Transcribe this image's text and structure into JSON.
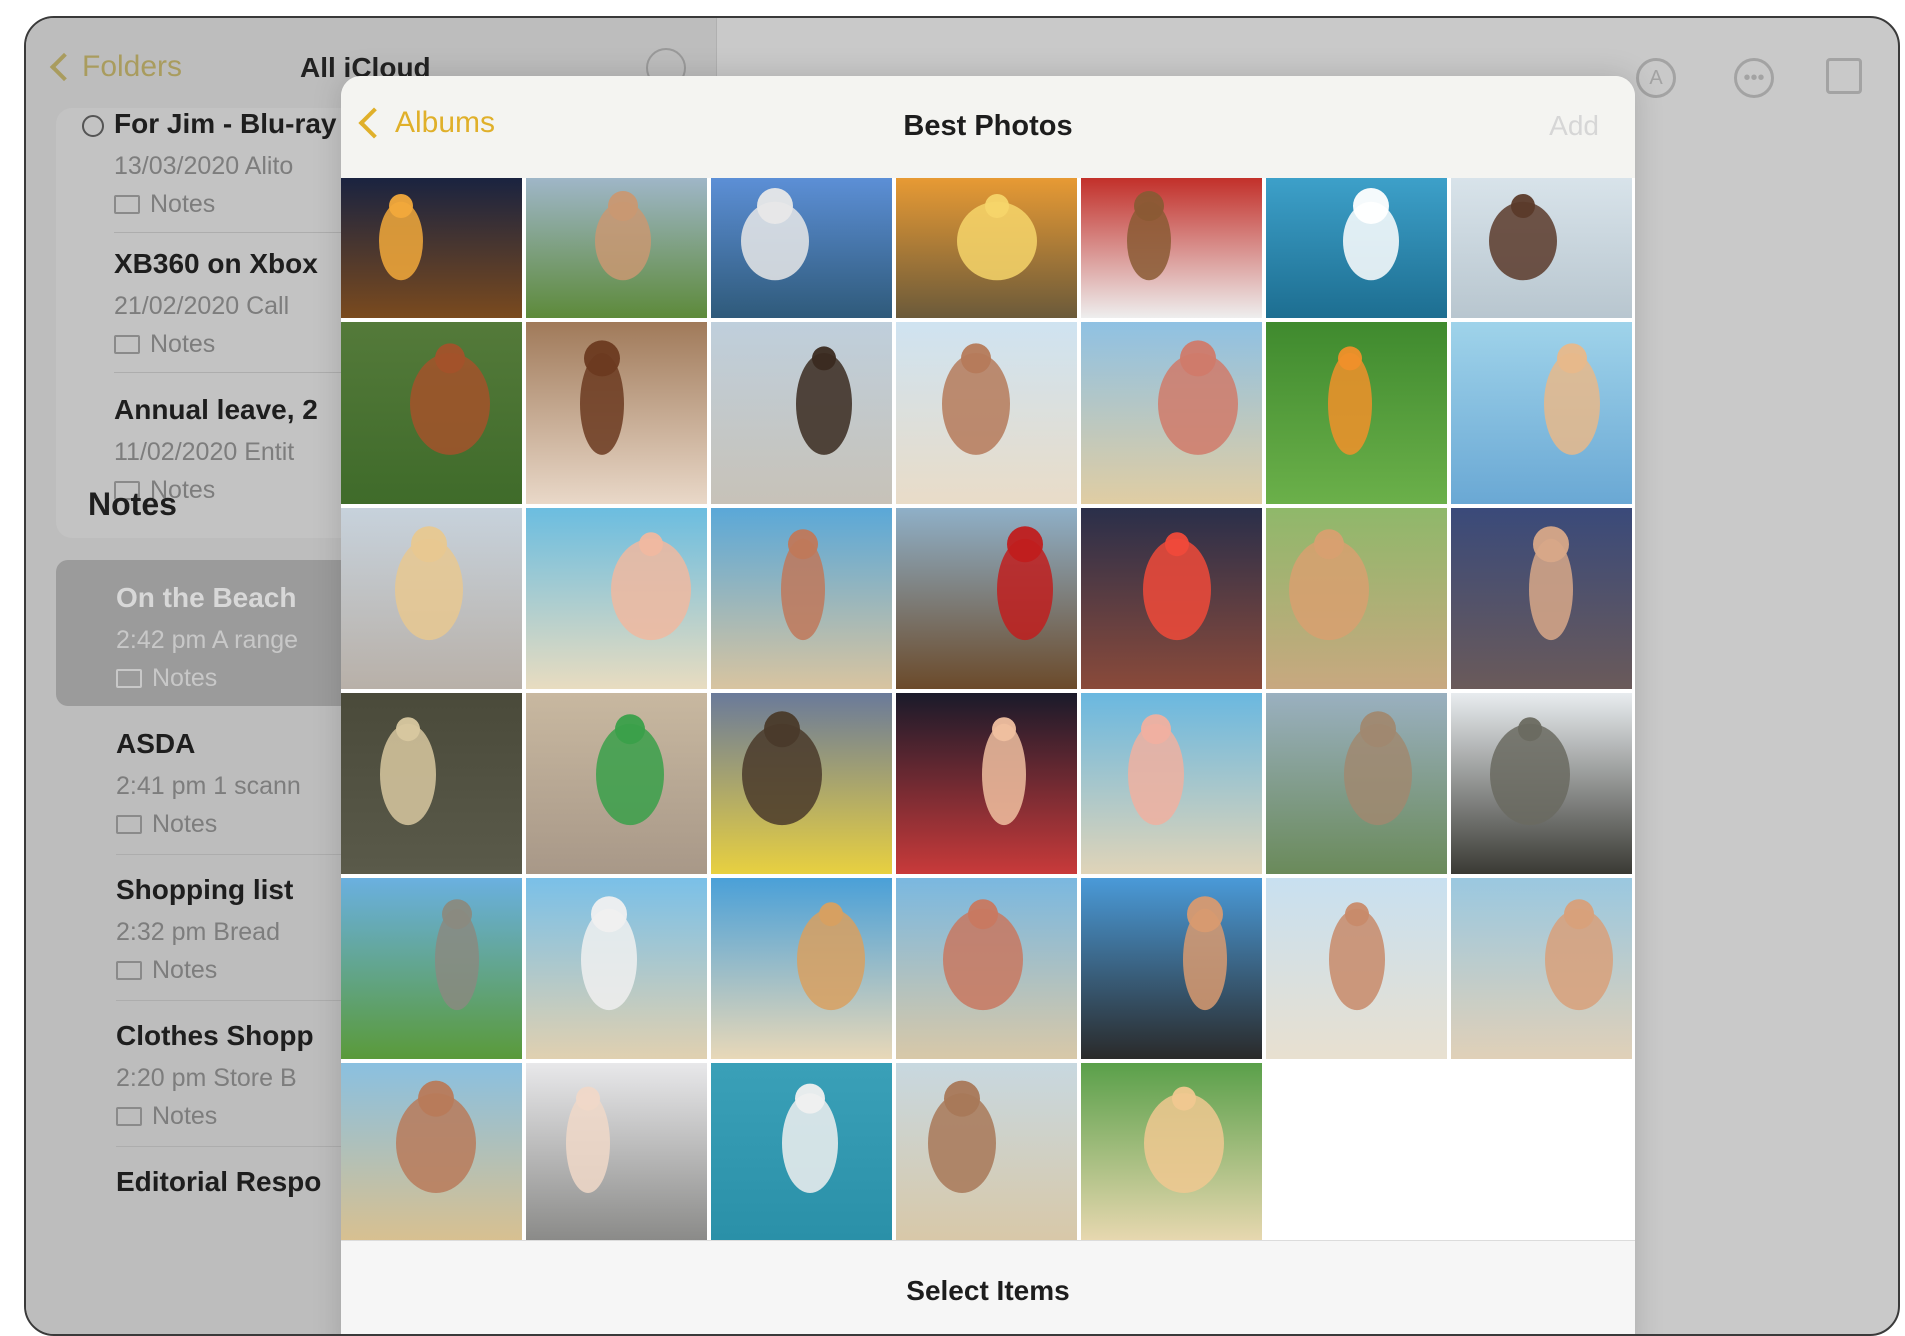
{
  "sidebar": {
    "back_label": "Folders",
    "title": "All iCloud",
    "pinned": [
      {
        "title": "For Jim - Blu-ray",
        "meta": "13/03/2020  Alito",
        "folder": "Notes"
      },
      {
        "title": "XB360 on Xbox",
        "meta": "21/02/2020  Call",
        "folder": "Notes"
      },
      {
        "title": "Annual leave, 2",
        "meta": "11/02/2020  Entit",
        "folder": "Notes"
      }
    ],
    "notes_heading": "Notes",
    "notes": [
      {
        "title": "On the Beach",
        "meta": "2:42 pm  A range",
        "folder": "Notes",
        "selected": true
      },
      {
        "title": "ASDA",
        "meta": "2:41 pm  1 scann",
        "folder": "Notes"
      },
      {
        "title": "Shopping list",
        "meta": "2:32 pm  Bread",
        "folder": "Notes"
      },
      {
        "title": "Clothes Shopp",
        "meta": "2:20 pm  Store B",
        "folder": "Notes"
      },
      {
        "title": "Editorial Respo",
        "meta": "",
        "folder": ""
      }
    ]
  },
  "toolbar": {
    "icons": [
      "markup-icon",
      "more-icon",
      "compose-icon"
    ]
  },
  "picker": {
    "back_label": "Albums",
    "title": "Best Photos",
    "add_label": "Add",
    "footer_label": "Select Items",
    "accent_color": "#e0b02a",
    "photos": [
      {
        "name": "city-night-photo",
        "sky": "#1a2340",
        "ground": "#7a4a1e",
        "accent": "#f2a93b"
      },
      {
        "name": "woman-sunglasses-photo",
        "sky": "#9fb6c8",
        "ground": "#5d8a3a",
        "accent": "#c99872"
      },
      {
        "name": "harbour-yachts-photo",
        "sky": "#5c8fd6",
        "ground": "#2f5a7a",
        "accent": "#e8e8e8"
      },
      {
        "name": "sunset-valley-photo",
        "sky": "#e79a34",
        "ground": "#6b5a3a",
        "accent": "#f6d56a"
      },
      {
        "name": "dogs-photo",
        "sky": "#c2302a",
        "ground": "#eeeeee",
        "accent": "#8a5a34"
      },
      {
        "name": "surfer-photo",
        "sky": "#3da0c9",
        "ground": "#1d6e91",
        "accent": "#ffffff"
      },
      {
        "name": "steps-photo",
        "sky": "#d8e3ea",
        "ground": "#b8c6cf",
        "accent": "#5b3a2a"
      },
      {
        "name": "horse-race-photo",
        "sky": "#547a3a",
        "ground": "#3f6b2a",
        "accent": "#a3522a"
      },
      {
        "name": "portrait-brunette-photo",
        "sky": "#a07a5a",
        "ground": "#e9d8c8",
        "accent": "#6b3a20"
      },
      {
        "name": "windswept-hair-photo",
        "sky": "#bfcfdc",
        "ground": "#c7c2b8",
        "accent": "#3a2a20"
      },
      {
        "name": "beach-runner-photo",
        "sky": "#cfe3f1",
        "ground": "#e9dcc8",
        "accent": "#b57a5a"
      },
      {
        "name": "family-beach-photo",
        "sky": "#8fc1e3",
        "ground": "#e0cda3",
        "accent": "#d07a6a"
      },
      {
        "name": "butterfly-photo",
        "sky": "#3f8a2e",
        "ground": "#6bb04a",
        "accent": "#f0902a"
      },
      {
        "name": "family-selfie-photo",
        "sky": "#9fd3ea",
        "ground": "#6aa8d4",
        "accent": "#e8b88a"
      },
      {
        "name": "eiffel-mother-photo",
        "sky": "#c7d2dc",
        "ground": "#b8b0a8",
        "accent": "#e8c890"
      },
      {
        "name": "child-sea-photo",
        "sky": "#6bbde0",
        "ground": "#e8dcc0",
        "accent": "#f0b8a0"
      },
      {
        "name": "friends-group-photo",
        "sky": "#5aa8d8",
        "ground": "#d8c4a0",
        "accent": "#c0785a"
      },
      {
        "name": "falconer-photo",
        "sky": "#8fb0c8",
        "ground": "#6b4a2a",
        "accent": "#c01e1e"
      },
      {
        "name": "times-square-photo",
        "sky": "#2a2f4a",
        "ground": "#8a4a3a",
        "accent": "#f04a3a"
      },
      {
        "name": "friends-garden-photo",
        "sky": "#8fb86a",
        "ground": "#c8a880",
        "accent": "#d8a070"
      },
      {
        "name": "women-night-photo",
        "sky": "#3a4a7a",
        "ground": "#6a5a5a",
        "accent": "#d8a888"
      },
      {
        "name": "cyclist-photo",
        "sky": "#4a4a3a",
        "ground": "#5a5a4a",
        "accent": "#d8c8a0"
      },
      {
        "name": "plaza-walker-photo",
        "sky": "#c8b8a0",
        "ground": "#a89888",
        "accent": "#3aa04a"
      },
      {
        "name": "street-woman-photo",
        "sky": "#6a7a9a",
        "ground": "#e8d040",
        "accent": "#4a3a2a"
      },
      {
        "name": "party-friends-photo",
        "sky": "#1a1a2a",
        "ground": "#c83a3a",
        "accent": "#f0c0a0"
      },
      {
        "name": "toddler-sea-photo",
        "sky": "#6ab8e0",
        "ground": "#e0d4b8",
        "accent": "#f0b0a0"
      },
      {
        "name": "mountain-lake-photo",
        "sky": "#9ab0c0",
        "ground": "#6a8a5a",
        "accent": "#a08870"
      },
      {
        "name": "tower-photo",
        "sky": "#e8ecef",
        "ground": "#3a3a34",
        "accent": "#6a6a60"
      },
      {
        "name": "alpine-meadow-photo",
        "sky": "#6ab0e0",
        "ground": "#5a9a3a",
        "accent": "#8a8a80"
      },
      {
        "name": "woman-driftwood-photo",
        "sky": "#7ac0e8",
        "ground": "#e0d0b0",
        "accent": "#f0f0f0"
      },
      {
        "name": "woman-straw-hat-photo",
        "sky": "#4aa0d8",
        "ground": "#e8d8b8",
        "accent": "#d8a060"
      },
      {
        "name": "beach-friends-photo",
        "sky": "#7ab8e0",
        "ground": "#d8c8a8",
        "accent": "#c87860"
      },
      {
        "name": "palm-pose-photo",
        "sky": "#4a9ad8",
        "ground": "#2a2a2a",
        "accent": "#d89a70"
      },
      {
        "name": "bikini-shore-photo",
        "sky": "#c8e0f0",
        "ground": "#e8e0d0",
        "accent": "#c88a6a"
      },
      {
        "name": "sunbather-photo",
        "sky": "#9ac8e0",
        "ground": "#e0d0b8",
        "accent": "#d8a07a"
      },
      {
        "name": "bikini-trio-photo",
        "sky": "#8ac0e0",
        "ground": "#d8c090",
        "accent": "#b87a5a"
      },
      {
        "name": "blonde-rocks-photo",
        "sky": "#e8e8ea",
        "ground": "#8a8a88",
        "accent": "#f0d8c8"
      },
      {
        "name": "swimmer-waves-photo",
        "sky": "#3aa0b8",
        "ground": "#2a90a8",
        "accent": "#f0f0f0"
      },
      {
        "name": "selfie-sand-photo",
        "sky": "#c8d8e0",
        "ground": "#d8c8a8",
        "accent": "#a87858"
      },
      {
        "name": "palm-blonde-photo",
        "sky": "#5aa04a",
        "ground": "#e8d8b0",
        "accent": "#f0c890"
      }
    ]
  }
}
